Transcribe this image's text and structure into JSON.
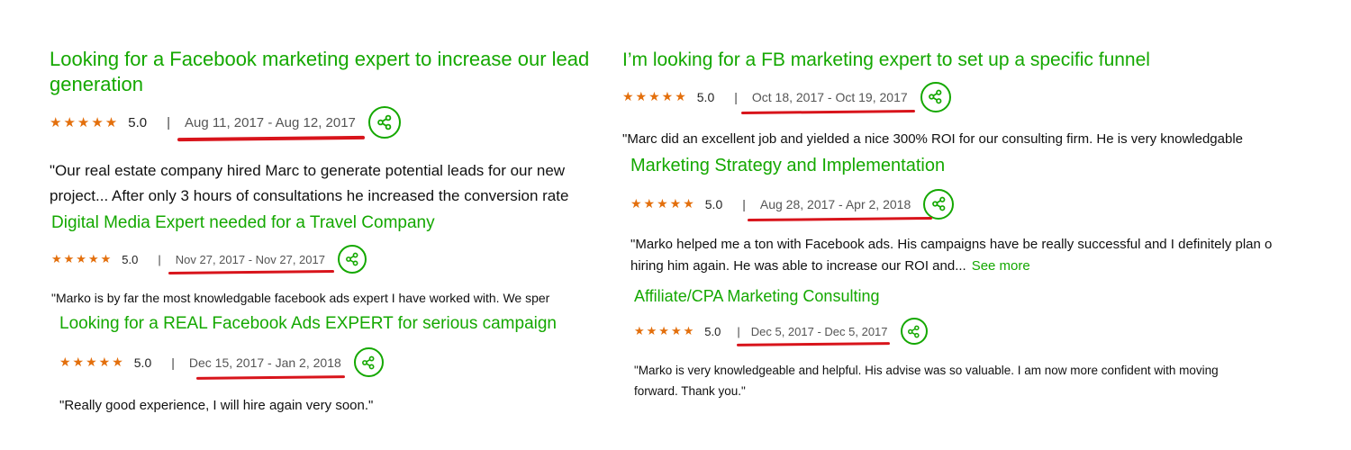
{
  "colors": {
    "accent_green": "#14a800",
    "star_orange": "#e36f0c",
    "underline_red": "#d8141b"
  },
  "icons": {
    "star": "star-icon",
    "share": "share-icon"
  },
  "reviews": [
    {
      "title_line1": "Looking for a Facebook marketing expert to increase our lead",
      "title_line2": "generation",
      "stars": "★★★★★",
      "rating": "5.0",
      "separator": "|",
      "dates": "Aug 11, 2017 - Aug 12, 2017",
      "text_line1": "\"Our real estate company hired Marc to generate potential leads for our new",
      "text_line2": "project... After only 3 hours of consultations he increased the conversion rate"
    },
    {
      "title": "Digital Media Expert needed for a Travel Company",
      "stars": "★★★★★",
      "rating": "5.0",
      "separator": "|",
      "dates": "Nov 27, 2017 - Nov 27, 2017",
      "text_line1": "\"Marko is by far the most knowledgable facebook ads expert I have worked with. We sper"
    },
    {
      "title": "Looking for a REAL Facebook Ads EXPERT for serious campaign",
      "stars": "★★★★★",
      "rating": "5.0",
      "separator": "|",
      "dates": "Dec 15, 2017 - Jan 2, 2018",
      "text_line1": "\"Really good experience, I will hire again very soon.\""
    },
    {
      "title": "I’m looking for a FB marketing expert to set up a specific funnel",
      "stars": "★★★★★",
      "rating": "5.0",
      "separator": "|",
      "dates": "Oct 18, 2017 - Oct 19, 2017",
      "text_line1": "\"Marc did an excellent job and yielded a nice 300% ROI for our consulting firm. He is very knowledgable"
    },
    {
      "title": "Marketing Strategy and Implementation",
      "stars": "★★★★★",
      "rating": "5.0",
      "separator": "|",
      "dates": "Aug 28, 2017 - Apr 2, 2018",
      "text_line1": "\"Marko helped me a ton with Facebook ads. His campaigns have be really successful and I definitely plan o",
      "text_line2": "hiring him again. He was able to increase our ROI and...",
      "see_more": "See more"
    },
    {
      "title": "Affiliate/CPA Marketing Consulting",
      "stars": "★★★★★",
      "rating": "5.0",
      "separator": "|",
      "dates": "Dec 5, 2017 - Dec 5, 2017",
      "text_line1": "\"Marko is very knowledgeable and helpful. His advise was so valuable. I am now more confident with moving",
      "text_line2": "forward. Thank you.\""
    }
  ]
}
